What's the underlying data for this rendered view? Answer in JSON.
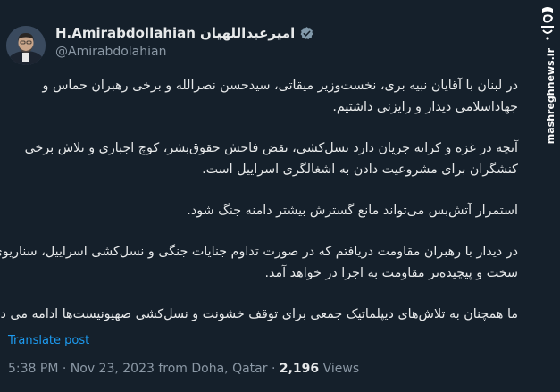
{
  "author": {
    "display_name_latin": "H.Amirabdollahian",
    "display_name_persian": "امیرعبداللهیان",
    "handle": "@Amirabdolahian",
    "verified": true
  },
  "watermark": {
    "logo_text": "مشرق",
    "url": "mashreghnews.ir"
  },
  "tweet": {
    "paragraphs": [
      {
        "line1": "در لبنان با آقایان نبیه بری، نخست‌وزیر میقاتی، سیدحسن نصرالله و برخی رهبران حماس و",
        "line2": "جهاداسلامی دیدار و رایزنی داشتیم."
      },
      {
        "line1": "آنچه در غزه و کرانه جریان دارد نسل‌کشی، نقض فاحش حقوق‌بشر، کوچ اجباری و تلاش برخی",
        "line2": "کنشگران برای مشروعیت دادن به اشغالگری اسراییل است."
      },
      {
        "line1": "استمرار آتش‌بس می‌تواند مانع گسترش بیشتر دامنه جنگ شود."
      },
      {
        "line1": "در دیدار با رهبران مقاومت دریافتم که در صورت تداوم جنایات جنگی و نسل‌کشی اسراییل، سناریوی",
        "line2": "سخت و پیچیده‌تر مقاومت به اجرا در خواهد آمد."
      },
      {
        "line1": "ما همچنان به تلاش‌های دیپلماتیک جمعی برای توقف خشونت و نسل‌کشی صهیونیست‌ها ادامه می دهیم."
      }
    ],
    "translate_label": "Translate post",
    "time": "5:38 PM",
    "separator": "·",
    "date_location": "Nov 23, 2023 from Doha, Qatar",
    "views_count": "2,196",
    "views_label": "Views"
  },
  "colors": {
    "background": "#15202b",
    "text": "#e7e9ea",
    "muted": "#8b98a5",
    "link": "#1d9bf0"
  }
}
